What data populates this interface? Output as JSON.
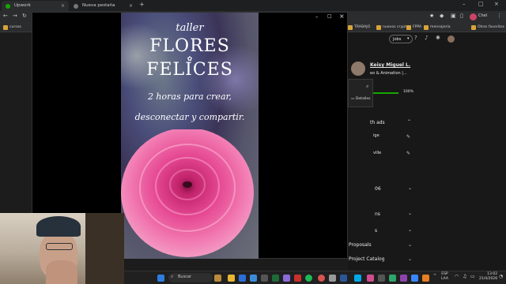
{
  "browser": {
    "tabs": [
      {
        "label": "Upwork",
        "active": true
      },
      {
        "label": "Nueva pestaña",
        "active": false
      }
    ],
    "new_tab_symbol": "+",
    "bookmarks": [
      "cursos",
      "TRABAJO",
      "nuevos cryptos",
      "FPPA",
      "mensajería"
    ],
    "bookmarks_right": "Otros favoritos",
    "profile_name": "Chel"
  },
  "poster": {
    "word_taller": "taller",
    "word_flores": "FLORES",
    "word_felices": "FELICES",
    "line1": "2 horas para crear,",
    "line2": "desconectar y compartir."
  },
  "popup": {
    "minimize": "–",
    "maximize": "□",
    "close": "×"
  },
  "page": {
    "jobs_dropdown": "Jobs",
    "user_name": "Keisy Miguel L.",
    "user_subtitle": "eo & Animation |...",
    "percent": "100%",
    "detalles": "Detalles",
    "section_ads": "th ads",
    "item1": "ige",
    "item2": "ville",
    "year_suffix": "06",
    "section_ns": "ns",
    "section_s": "s",
    "proposals": "Proposals",
    "project_catalog": "Project Catalog"
  },
  "taskbar": {
    "search": "Buscar",
    "lang_top": "ESP",
    "lang_bottom": "LAA",
    "time": "13:02",
    "date": "21/4/2026"
  },
  "colors": {
    "accent_green": "#14a800",
    "chrome_bg": "#2b2c2e",
    "page_bg": "#181818"
  }
}
